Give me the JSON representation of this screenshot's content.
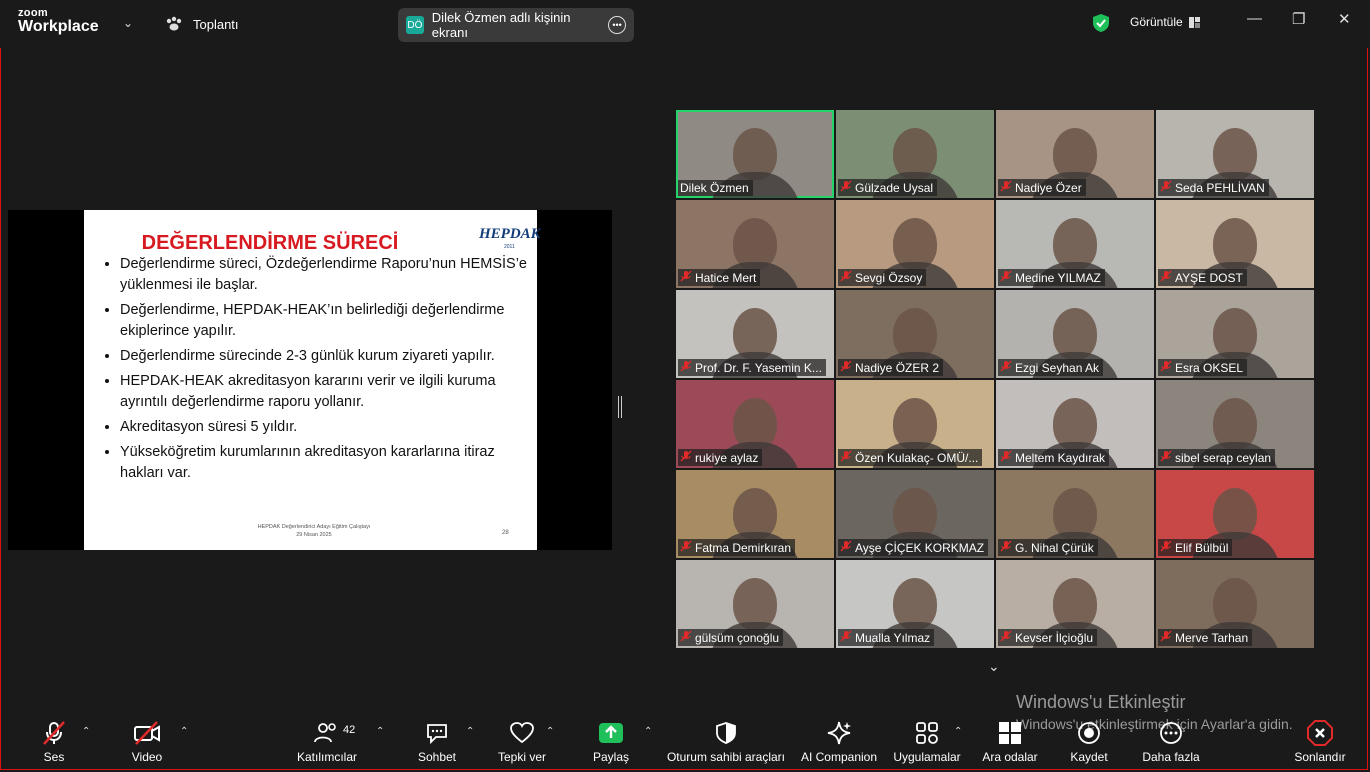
{
  "titlebar": {
    "logo_top": "zoom",
    "logo_bottom": "Workplace",
    "meeting_label": "Toplantı",
    "share_avatar": "DÖ",
    "share_label": "Dilek Özmen adlı kişinin ekranı",
    "view_label": "Görüntüle"
  },
  "slide": {
    "title": "DEĞERLENDİRME SÜRECİ",
    "logo": "HEPDAK",
    "logo_sub": "2011",
    "bullets": [
      "Değerlendirme süreci,  Özdeğerlendirme Raporu’nun HEMSİS’e yüklenmesi ile başlar.",
      "Değerlendirme, HEPDAK-HEAK’ın belirlediği değerlendirme  ekiplerince yapılır.",
      "Değerlendirme sürecinde 2-3 günlük kurum ziyareti yapılır.",
      "HEPDAK-HEAK akreditasyon kararını verir ve ilgili kuruma  ayrıntılı  değerlendirme raporu yollanır.",
      "Akreditasyon süresi  5  yıldır.",
      "Yükseköğretim kurumlarının akreditasyon kararlarına itiraz hakları var."
    ],
    "footer_line1": "HEPDAK Değerlendirici Adayı Eğitim Çalıştayı",
    "footer_line2": "29 Nisan  2025",
    "page": "28"
  },
  "participants": [
    {
      "name": "Dilek Özmen",
      "muted": false,
      "active": true,
      "bg": "#8f8a84"
    },
    {
      "name": "Gülzade Uysal",
      "muted": true,
      "active": false,
      "bg": "#7c8f74"
    },
    {
      "name": "Nadiye Özer",
      "muted": true,
      "active": false,
      "bg": "#a89484"
    },
    {
      "name": "Seda PEHLİVAN",
      "muted": true,
      "active": false,
      "bg": "#b8b4ae"
    },
    {
      "name": "Hatice Mert",
      "muted": true,
      "active": false,
      "bg": "#8d7565"
    },
    {
      "name": "Sevgi Özsoy",
      "muted": true,
      "active": false,
      "bg": "#b89a80"
    },
    {
      "name": "Medine YILMAZ",
      "muted": true,
      "active": false,
      "bg": "#b8b8b4"
    },
    {
      "name": "AYŞE DOST",
      "muted": true,
      "active": false,
      "bg": "#c9b8a4"
    },
    {
      "name": "Prof. Dr. F. Yasemin K...",
      "muted": true,
      "active": false,
      "bg": "#c4c2be"
    },
    {
      "name": "Nadiye ÖZER 2",
      "muted": true,
      "active": false,
      "bg": "#7e6e60"
    },
    {
      "name": "Ezgi Seyhan Ak",
      "muted": true,
      "active": false,
      "bg": "#b4b2ae"
    },
    {
      "name": "Esra OKSEL",
      "muted": true,
      "active": false,
      "bg": "#aaa49a"
    },
    {
      "name": "rukiye aylaz",
      "muted": true,
      "active": false,
      "bg": "#9c4a58"
    },
    {
      "name": "Özen Kulakaç- OMÜ/...",
      "muted": true,
      "active": false,
      "bg": "#c8b08a"
    },
    {
      "name": "Meltem Kaydırak",
      "muted": true,
      "active": false,
      "bg": "#c2bebc"
    },
    {
      "name": "sibel serap ceylan",
      "muted": true,
      "active": false,
      "bg": "#8c857e"
    },
    {
      "name": "Fatma Demirkıran",
      "muted": true,
      "active": false,
      "bg": "#a88c64"
    },
    {
      "name": "Ayşe ÇİÇEK KORKMAZ",
      "muted": true,
      "active": false,
      "bg": "#6c6660"
    },
    {
      "name": "G. Nihal Çürük",
      "muted": true,
      "active": false,
      "bg": "#8c7860"
    },
    {
      "name": "Elif Bülbül",
      "muted": true,
      "active": false,
      "bg": "#c84848"
    },
    {
      "name": "gülsüm çonoğlu",
      "muted": true,
      "active": false,
      "bg": "#b8b4b0"
    },
    {
      "name": "Mualla Yılmaz",
      "muted": true,
      "active": false,
      "bg": "#c6c6c4"
    },
    {
      "name": "Kevser İlçioğlu",
      "muted": true,
      "active": false,
      "bg": "#b8aea4"
    },
    {
      "name": "Merve Tarhan",
      "muted": true,
      "active": false,
      "bg": "#7e6c5c"
    }
  ],
  "watermark": {
    "line1": "Windows'u Etkinleştir",
    "line2": "Windows'u etkinleştirmek için Ayarlar'a gidin."
  },
  "toolbar": {
    "audio": "Ses",
    "video": "Video",
    "participants": "Katılımcılar",
    "participants_count": "42",
    "chat": "Sohbet",
    "react": "Tepki ver",
    "share": "Paylaş",
    "host_tools": "Oturum sahibi araçları",
    "ai": "AI Companion",
    "apps": "Uygulamalar",
    "breakout": "Ara odalar",
    "record": "Kaydet",
    "more": "Daha fazla",
    "end": "Sonlandır"
  },
  "colors": {
    "accent_green": "#24d36a",
    "share_green": "#1fbf5a",
    "end_red": "#e02a2a"
  }
}
